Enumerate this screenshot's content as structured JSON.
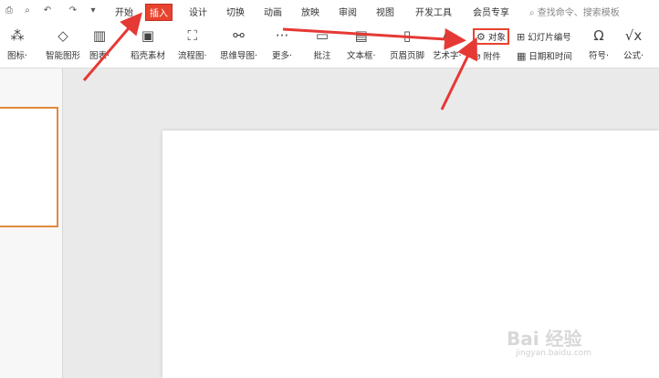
{
  "quick_access": {
    "icons": [
      "print-icon",
      "preview-icon",
      "undo-icon",
      "redo-icon",
      "customize-icon"
    ]
  },
  "menu_tabs": [
    "开始",
    "插入",
    "设计",
    "切换",
    "动画",
    "放映",
    "审阅",
    "视图",
    "开发工具",
    "会员专享"
  ],
  "active_tab": "插入",
  "search": {
    "placeholder": "查找命令、搜索模板"
  },
  "ribbon": {
    "buttons": [
      {
        "label": "图标·",
        "icon": "icon-library-icon"
      },
      {
        "label": "智能图形",
        "icon": "smartart-icon"
      },
      {
        "label": "图表·",
        "icon": "chart-icon"
      },
      {
        "label": "稻壳素材",
        "icon": "material-icon"
      },
      {
        "label": "流程图·",
        "icon": "flowchart-icon"
      },
      {
        "label": "思维导图·",
        "icon": "mindmap-icon"
      },
      {
        "label": "更多·",
        "icon": "more-icon"
      },
      {
        "label": "批注",
        "icon": "comment-icon"
      },
      {
        "label": "文本框·",
        "icon": "textbox-icon"
      },
      {
        "label": "页眉页脚",
        "icon": "header-footer-icon"
      },
      {
        "label": "艺术字·",
        "icon": "wordart-icon"
      },
      {
        "label": "符号·",
        "icon": "symbol-icon"
      },
      {
        "label": "公式·",
        "icon": "formula-icon"
      }
    ],
    "small_buttons": {
      "object": "对象",
      "attachment": "附件",
      "slide_number": "幻灯片编号",
      "date_time": "日期和时间"
    }
  },
  "watermark": {
    "main": "Bai 经验",
    "sub": "jingyan.baidu.com"
  },
  "colors": {
    "accent": "#e8432e",
    "thumb_border": "#e08a3c"
  }
}
